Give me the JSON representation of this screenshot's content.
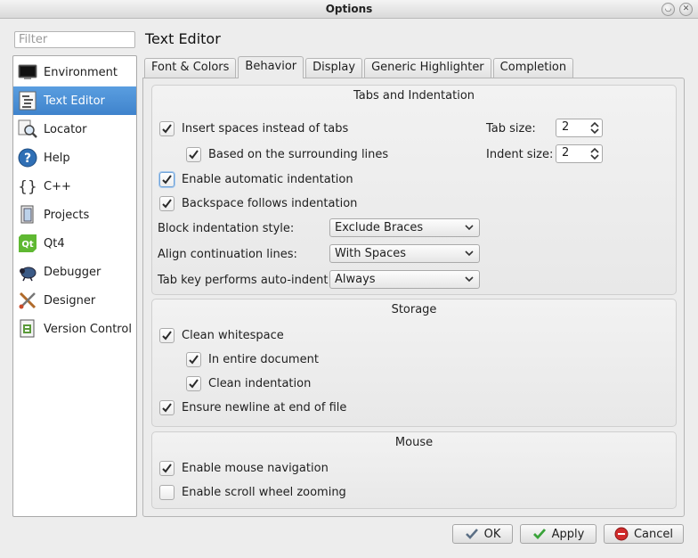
{
  "window": {
    "title": "Options"
  },
  "filter": {
    "placeholder": "Filter"
  },
  "sidebar": {
    "items": [
      {
        "label": "Environment"
      },
      {
        "label": "Text Editor"
      },
      {
        "label": "Locator"
      },
      {
        "label": "Help"
      },
      {
        "label": "C++"
      },
      {
        "label": "Projects"
      },
      {
        "label": "Qt4"
      },
      {
        "label": "Debugger"
      },
      {
        "label": "Designer"
      },
      {
        "label": "Version Control"
      }
    ],
    "selected": "Text Editor"
  },
  "page": {
    "title": "Text Editor"
  },
  "tabs": [
    {
      "label": "Font & Colors"
    },
    {
      "label": "Behavior"
    },
    {
      "label": "Display"
    },
    {
      "label": "Generic Highlighter"
    },
    {
      "label": "Completion"
    }
  ],
  "active_tab": "Behavior",
  "tabs_indentation": {
    "title": "Tabs and Indentation",
    "insert_spaces": {
      "label": "Insert spaces instead of tabs",
      "checked": true
    },
    "based_on_surrounding": {
      "label": "Based on the surrounding lines",
      "checked": true
    },
    "auto_indent": {
      "label": "Enable automatic indentation",
      "checked": true
    },
    "backspace_indent": {
      "label": "Backspace follows indentation",
      "checked": true
    },
    "tab_size": {
      "label": "Tab size:",
      "value": "2"
    },
    "indent_size": {
      "label": "Indent size:",
      "value": "2"
    },
    "block_style": {
      "label": "Block indentation style:",
      "value": "Exclude Braces"
    },
    "continuation": {
      "label": "Align continuation lines:",
      "value": "With Spaces"
    },
    "tab_key": {
      "label": "Tab key performs auto-indent:",
      "value": "Always"
    }
  },
  "storage": {
    "title": "Storage",
    "clean_whitespace": {
      "label": "Clean whitespace",
      "checked": true
    },
    "entire_document": {
      "label": "In entire document",
      "checked": true
    },
    "clean_indentation": {
      "label": "Clean indentation",
      "checked": true
    },
    "ensure_newline": {
      "label": "Ensure newline at end of file",
      "checked": true
    }
  },
  "mouse": {
    "title": "Mouse",
    "mouse_navigation": {
      "label": "Enable mouse navigation",
      "checked": true
    },
    "scroll_zoom": {
      "label": "Enable scroll wheel zooming",
      "checked": false
    }
  },
  "buttons": {
    "ok": "OK",
    "apply": "Apply",
    "cancel": "Cancel"
  },
  "colors": {
    "selection": "#3f83cc",
    "check": "#2a2a2a",
    "apply_icon": "#3aa33a",
    "cancel_icon": "#d12b2b"
  }
}
